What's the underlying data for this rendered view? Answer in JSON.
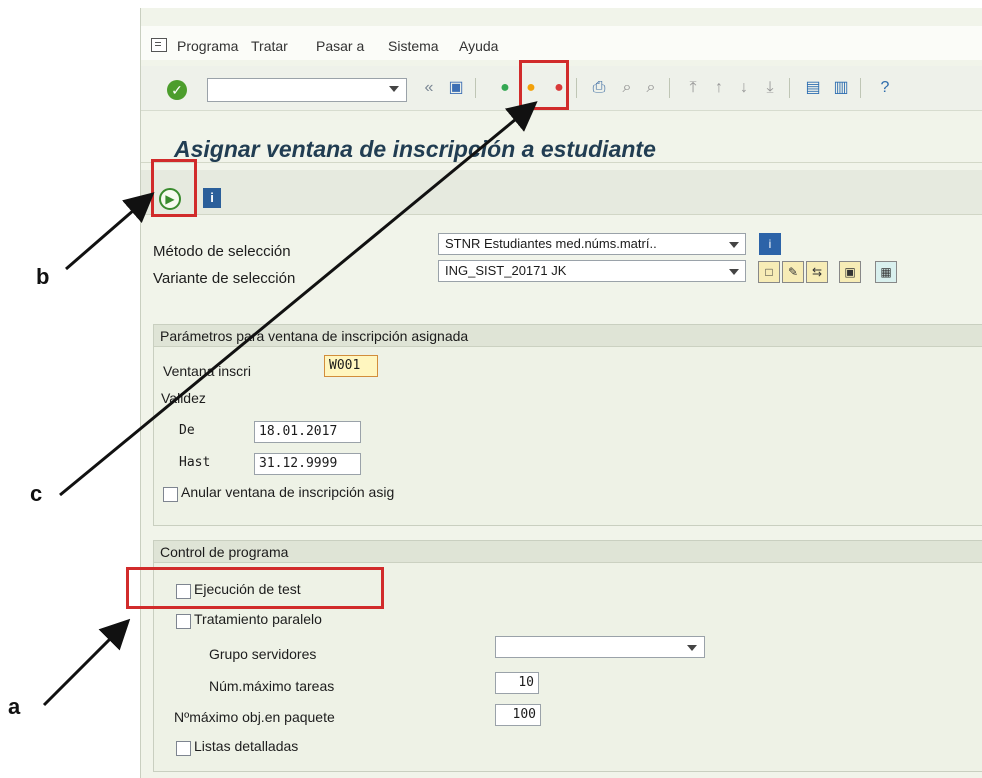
{
  "menu": {
    "items": [
      "Programa",
      "Tratar",
      "Pasar a",
      "Sistema",
      "Ayuda"
    ]
  },
  "toolbar": {
    "command_value": "",
    "icons": {
      "ok": "checkmark-icon",
      "double_left": "«",
      "save": "save-icon",
      "back": "back-icon",
      "exit": "exit-icon",
      "cancel": "cancel-icon",
      "print": "print-icon",
      "find": "find-icon",
      "find_next": "find-next-icon",
      "first_page": "first-page-icon",
      "prev_page": "prev-page-icon",
      "next_page": "next-page-icon",
      "last_page": "last-page-icon",
      "new_session": "new-session-icon",
      "shortcut": "shortcut-icon",
      "help": "help-icon"
    }
  },
  "page": {
    "title": "Asignar ventana de inscripción a estudiante"
  },
  "app_toolbar": {
    "execute_icon": "execute-icon",
    "info_icon": "i"
  },
  "selection": {
    "method_label": "Método de selección",
    "method_value": "STNR Estudiantes med.núms.matrí..",
    "variant_label": "Variante de selección",
    "variant_value": "ING_SIST_20171 JK",
    "info_button": "i"
  },
  "params": {
    "title": "Parámetros para ventana de inscripción asignada",
    "window_label": "Ventana inscri",
    "window_value": "W001",
    "validity_label": "Validez",
    "from_label": "De",
    "from_value": "18.01.2017",
    "to_label": "Hast",
    "to_value": "31.12.9999",
    "cancel_label": "Anular ventana de inscripción asig"
  },
  "program_control": {
    "title": "Control de programa",
    "test_run_label": "Ejecución de test",
    "parallel_label": "Tratamiento paralelo",
    "server_group_label": "Grupo servidores",
    "server_group_value": "",
    "max_tasks_label": "Núm.máximo tareas",
    "max_tasks_value": "10",
    "max_objects_label": "Nºmáximo obj.en paquete",
    "max_objects_value": "100",
    "detailed_lists_label": "Listas detalladas"
  },
  "annotations": {
    "a": "a",
    "b": "b",
    "c": "c"
  },
  "colors": {
    "annotation_red": "#d12b2b",
    "sap_background": "#f1f4ea",
    "title_color": "#213d52"
  }
}
